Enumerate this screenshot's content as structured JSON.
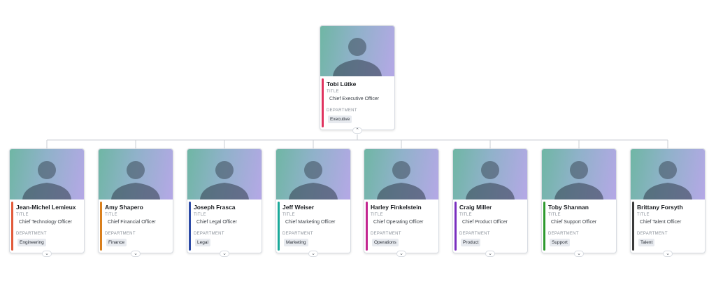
{
  "root": {
    "name": "Tobi Lütke",
    "title_label": "TITLE",
    "title": "Chief Executive Officer",
    "dept_label": "DEPARTMENT",
    "department": "Executive",
    "accent": "#e0335f",
    "toggle_icon": "chevron-up-icon",
    "toggle_glyph": "⌃"
  },
  "reports": [
    {
      "name": "Jean-Michel Lemieux",
      "title_label": "TITLE",
      "title": "Chief Technology Officer",
      "dept_label": "DEPARTMENT",
      "department": "Engineering",
      "accent": "#e25a3a",
      "toggle_glyph": "⌄"
    },
    {
      "name": "Amy Shapero",
      "title_label": "TITLE",
      "title": "Chief Financial Officer",
      "dept_label": "DEPARTMENT",
      "department": "Finance",
      "accent": "#d97f1d",
      "toggle_glyph": "⌄"
    },
    {
      "name": "Joseph Frasca",
      "title_label": "TITLE",
      "title": "Chief Legal Officer",
      "dept_label": "DEPARTMENT",
      "department": "Legal",
      "accent": "#2c4aa6",
      "toggle_glyph": "⌄"
    },
    {
      "name": "Jeff Weiser",
      "title_label": "TITLE",
      "title": "Chief Marketing Officer",
      "dept_label": "DEPARTMENT",
      "department": "Marketing",
      "accent": "#1aa99a",
      "toggle_glyph": "⌄"
    },
    {
      "name": "Harley Finkelstein",
      "title_label": "TITLE",
      "title": "Chief Operating Officer",
      "dept_label": "DEPARTMENT",
      "department": "Operations",
      "accent": "#c3258f",
      "toggle_glyph": "⌄"
    },
    {
      "name": "Craig Miller",
      "title_label": "TITLE",
      "title": "Chief Product Officer",
      "dept_label": "DEPARTMENT",
      "department": "Product",
      "accent": "#7a2fbf",
      "toggle_glyph": "⌄"
    },
    {
      "name": "Toby Shannan",
      "title_label": "TITLE",
      "title": "Chief Support Officer",
      "dept_label": "DEPARTMENT",
      "department": "Support",
      "accent": "#2e9a2e",
      "toggle_glyph": "⌄"
    },
    {
      "name": "Brittany Forsyth",
      "title_label": "TITLE",
      "title": "Chief Talent Officer",
      "dept_label": "DEPARTMENT",
      "department": "Talent",
      "accent": "#3a3a3a",
      "toggle_glyph": "⌄"
    }
  ],
  "icons": {
    "photo": "person-avatar-icon",
    "expand": "chevron-down-icon",
    "collapse": "chevron-up-icon"
  }
}
